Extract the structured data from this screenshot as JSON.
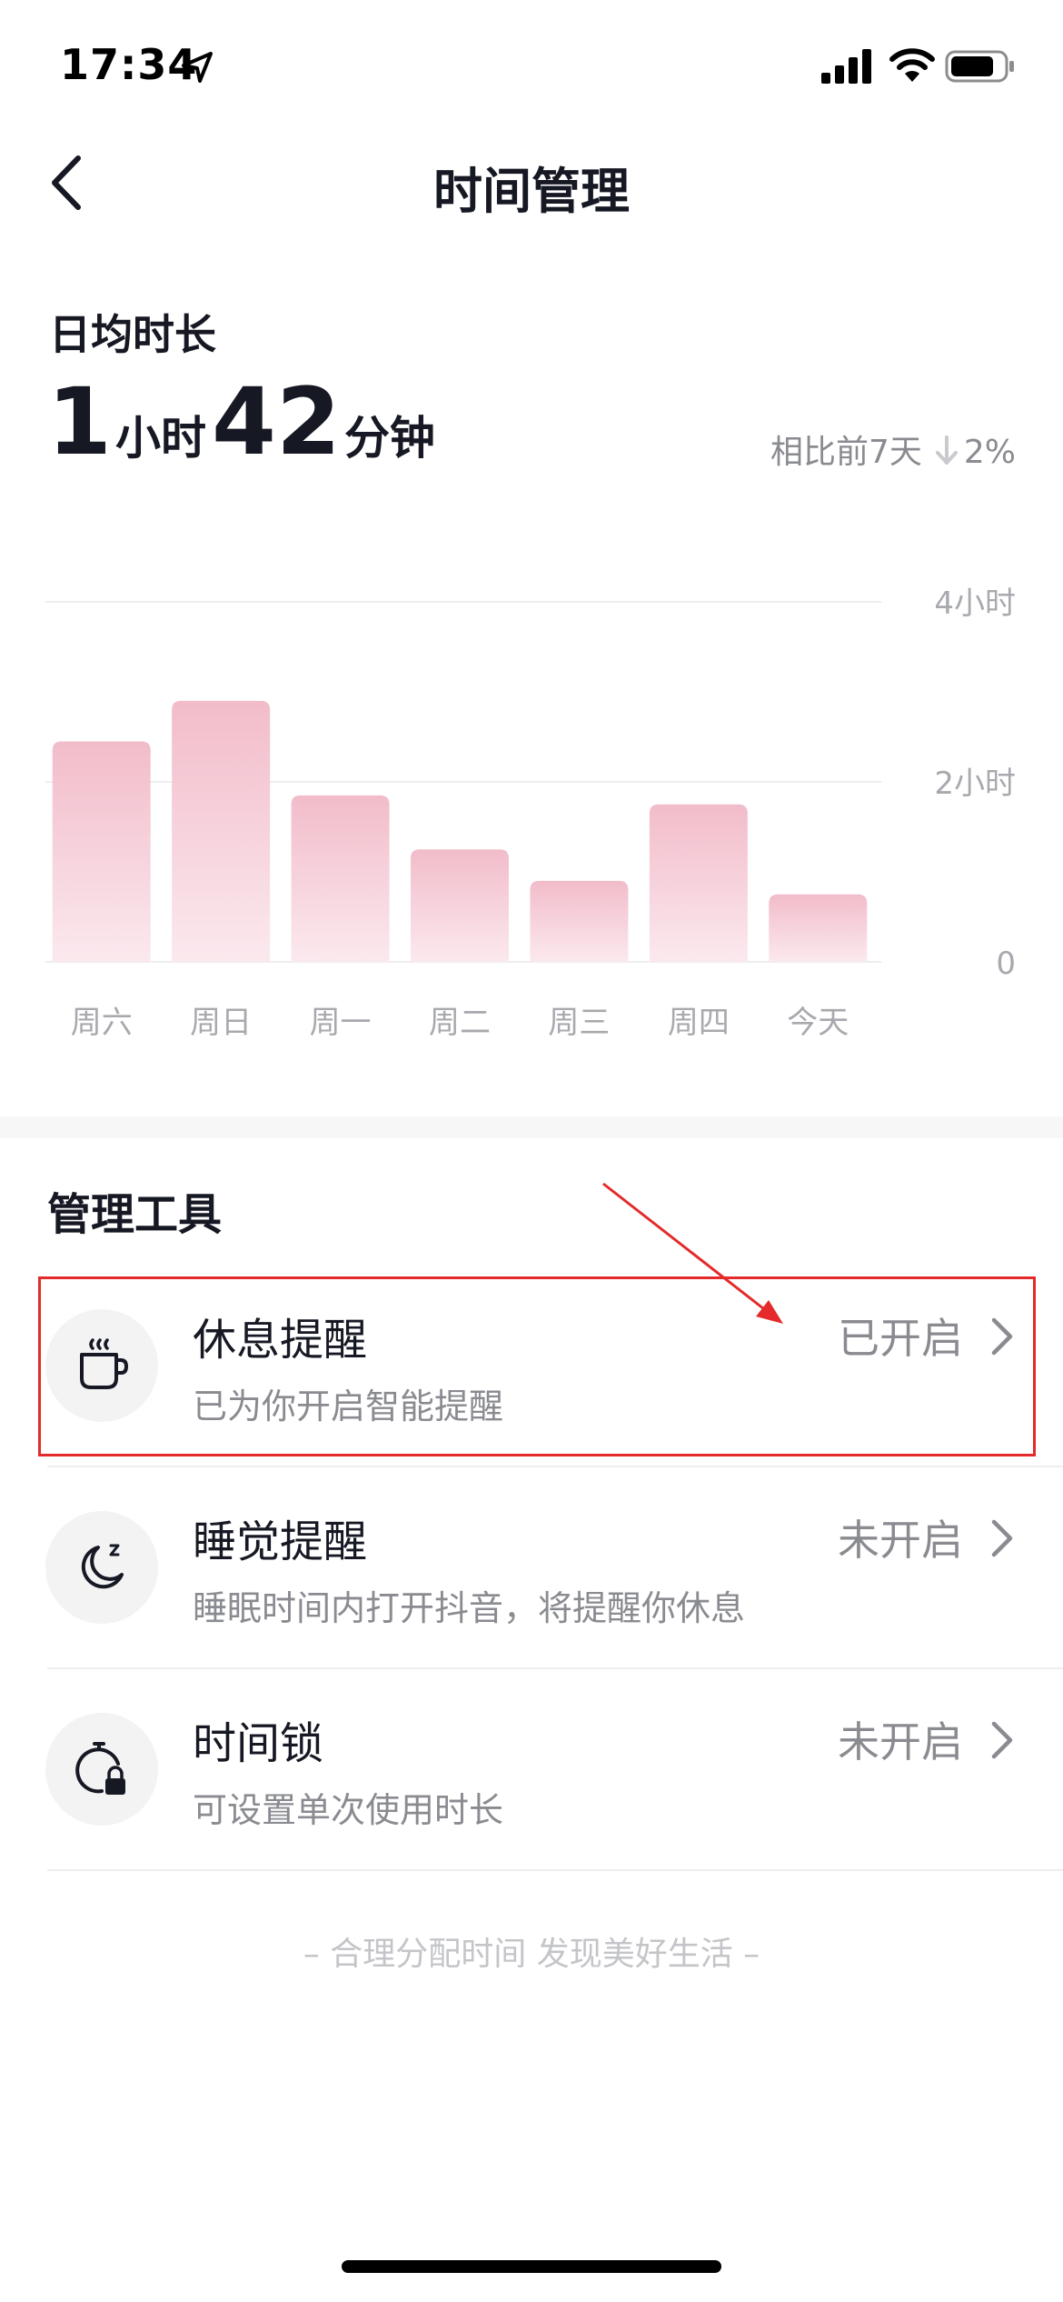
{
  "status_bar": {
    "time": "17:34"
  },
  "nav": {
    "title": "时间管理"
  },
  "summary": {
    "label": "日均时长",
    "hours": "1",
    "hours_unit": "小时",
    "minutes": "42",
    "minutes_unit": "分钟",
    "compare_label": "相比前7天",
    "compare_value": "2%"
  },
  "chart_data": {
    "type": "bar",
    "categories": [
      "周六",
      "周日",
      "周一",
      "周二",
      "周三",
      "周四",
      "今天"
    ],
    "values": [
      2.45,
      2.9,
      1.85,
      1.25,
      0.9,
      1.75,
      0.75
    ],
    "ylim": [
      0,
      4
    ],
    "yticks": [
      {
        "value": 4,
        "label": "4小时"
      },
      {
        "value": 2,
        "label": "2小时"
      },
      {
        "value": 0,
        "label": "0"
      }
    ],
    "grid": true,
    "bar_color_top": "#f2bcca",
    "bar_color_bottom": "#fbe9ee"
  },
  "tools": {
    "title": "管理工具",
    "items": [
      {
        "name": "休息提醒",
        "desc": "已为你开启智能提醒",
        "status": "已开启",
        "icon": "coffee-cup-icon"
      },
      {
        "name": "睡觉提醒",
        "desc": "睡眠时间内打开抖音，将提醒你休息",
        "status": "未开启",
        "icon": "moon-sleep-icon"
      },
      {
        "name": "时间锁",
        "desc": "可设置单次使用时长",
        "status": "未开启",
        "icon": "timer-lock-icon"
      }
    ]
  },
  "footer": {
    "slogan": "– 合理分配时间 发现美好生活 –"
  },
  "colors": {
    "annotation": "#e42a2a",
    "text_primary": "#161823",
    "text_secondary": "#8a8b91"
  }
}
